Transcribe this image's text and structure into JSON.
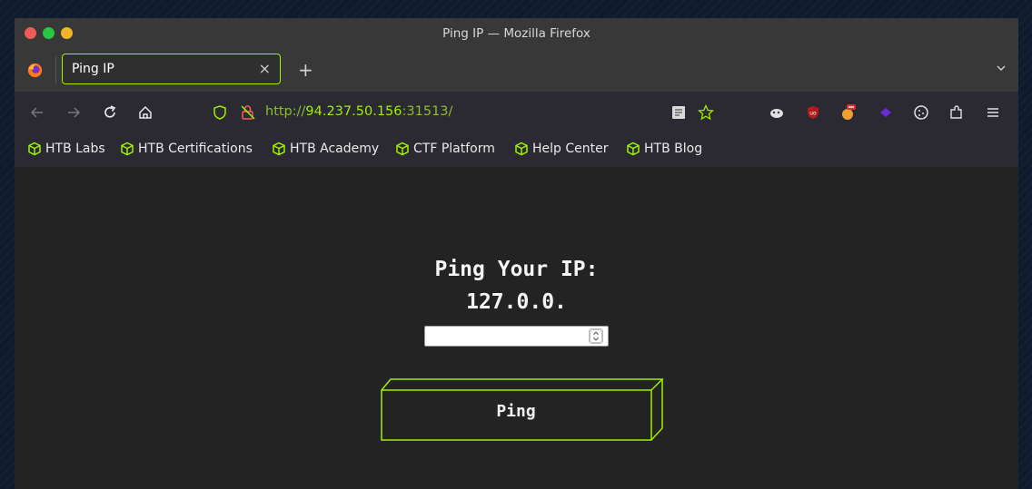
{
  "window": {
    "title": "Ping IP — Mozilla Firefox"
  },
  "tab": {
    "label": "Ping IP",
    "close_glyph": "×",
    "new_tab_glyph": "+"
  },
  "navbar": {
    "url_scheme": "http://",
    "url_host": "94.237.50.156",
    "url_port": ":31513/"
  },
  "bookmarks": [
    {
      "label": "HTB Labs"
    },
    {
      "label": "HTB Certifications"
    },
    {
      "label": "HTB Academy"
    },
    {
      "label": "CTF Platform"
    },
    {
      "label": "Help Center"
    },
    {
      "label": "HTB Blog"
    }
  ],
  "page": {
    "heading": "Ping Your IP:",
    "ip_prefix": "127.0.0.",
    "input_value": "",
    "button_label": "Ping"
  },
  "colors": {
    "accent": "#9fef00",
    "background": "#232323",
    "chrome": "#383838",
    "toolbar": "#2b2a33"
  }
}
